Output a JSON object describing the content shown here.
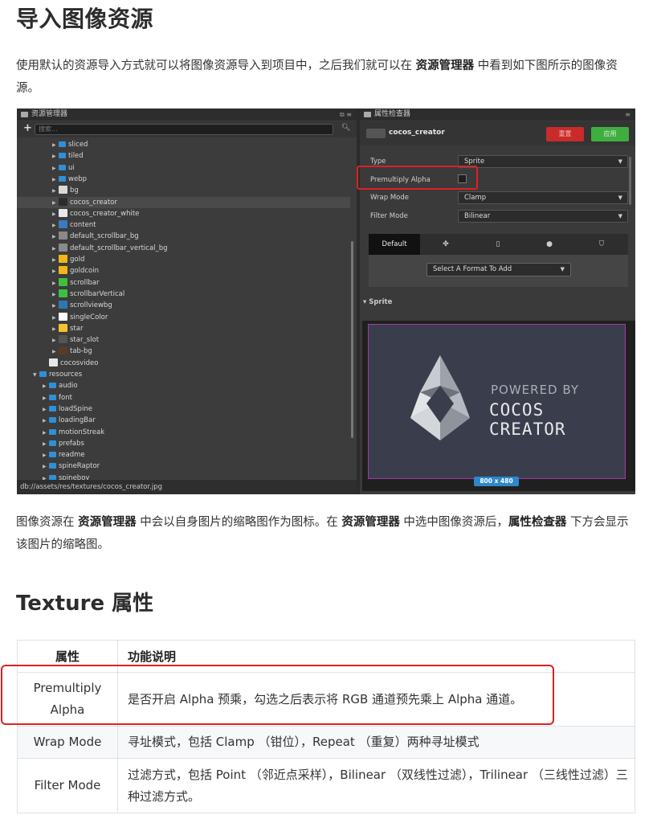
{
  "heading1": "导入图像资源",
  "intro": {
    "part1": "使用默认的资源导入方式就可以将图像资源导入到项目中，之后我们就可以在 ",
    "bold1": "资源管理器",
    "part2": " 中看到如下图所示的图像资源。"
  },
  "assets_panel": {
    "title": "资源管理器",
    "search_placeholder": "搜索...",
    "status_path": "db://assets/res/textures/cocos_creator.jpg",
    "tree": [
      {
        "name": "sliced",
        "kind": "folder",
        "indent": 2
      },
      {
        "name": "tiled",
        "kind": "folder",
        "indent": 2
      },
      {
        "name": "ui",
        "kind": "folder",
        "indent": 2
      },
      {
        "name": "webp",
        "kind": "folder",
        "indent": 2
      },
      {
        "name": "bg",
        "kind": "image",
        "indent": 2,
        "color": "#d9d9d9"
      },
      {
        "name": "cocos_creator",
        "kind": "image",
        "indent": 2,
        "color": "#2c2c2c",
        "selected": true
      },
      {
        "name": "cocos_creator_white",
        "kind": "image",
        "indent": 2,
        "color": "#e8e8e8"
      },
      {
        "name": "content",
        "kind": "image",
        "indent": 2,
        "color": "#3a7abf"
      },
      {
        "name": "default_scrollbar_bg",
        "kind": "image",
        "indent": 2,
        "color": "#8a8a8a"
      },
      {
        "name": "default_scrollbar_vertical_bg",
        "kind": "image",
        "indent": 2,
        "color": "#8a8a8a"
      },
      {
        "name": "gold",
        "kind": "image",
        "indent": 2,
        "color": "#f2b619"
      },
      {
        "name": "goldcoin",
        "kind": "image",
        "indent": 2,
        "color": "#f2b619"
      },
      {
        "name": "scrollbar",
        "kind": "image",
        "indent": 2,
        "color": "#3fbf3f"
      },
      {
        "name": "scrollbarVertical",
        "kind": "image",
        "indent": 2,
        "color": "#3fbf3f"
      },
      {
        "name": "scrollviewbg",
        "kind": "image",
        "indent": 2,
        "color": "#2d78b0"
      },
      {
        "name": "singleColor",
        "kind": "image",
        "indent": 2,
        "color": "#ffffff"
      },
      {
        "name": "star",
        "kind": "image",
        "indent": 2,
        "color": "#f2c230"
      },
      {
        "name": "star_slot",
        "kind": "image",
        "indent": 2,
        "color": "#555555"
      },
      {
        "name": "tab-bg",
        "kind": "image",
        "indent": 2,
        "color": "#5a3b25"
      },
      {
        "name": "cocosvideo",
        "kind": "file",
        "indent": 1,
        "color": "#e6e6e6"
      },
      {
        "name": "resources",
        "kind": "folder-open",
        "indent": 0
      },
      {
        "name": "audio",
        "kind": "folder",
        "indent": 1
      },
      {
        "name": "font",
        "kind": "folder",
        "indent": 1
      },
      {
        "name": "loadSpine",
        "kind": "folder",
        "indent": 1
      },
      {
        "name": "loadingBar",
        "kind": "folder",
        "indent": 1
      },
      {
        "name": "motionStreak",
        "kind": "folder",
        "indent": 1
      },
      {
        "name": "prefabs",
        "kind": "folder",
        "indent": 1
      },
      {
        "name": "readme",
        "kind": "folder",
        "indent": 1
      },
      {
        "name": "spineRaptor",
        "kind": "folder",
        "indent": 1
      },
      {
        "name": "spineboy",
        "kind": "folder",
        "indent": 1
      }
    ]
  },
  "inspector": {
    "title": "属性检查器",
    "asset_name": "cocos_creator",
    "revert_label": "重置",
    "apply_label": "应用",
    "props": [
      {
        "label": "Type",
        "value": "Sprite"
      },
      {
        "label": "Premultiply Alpha",
        "value": ""
      },
      {
        "label": "Wrap Mode",
        "value": "Clamp"
      },
      {
        "label": "Filter Mode",
        "value": "Bilinear"
      }
    ],
    "platform_default": "Default",
    "format_select": "Select A Format To Add",
    "sprite_section": "▾ Sprite",
    "preview_line1": "POWERED BY",
    "preview_line2": "COCOS CREATOR",
    "preview_size": "800 x 480"
  },
  "para2": {
    "a": "图像资源在 ",
    "b1": "资源管理器",
    "c": " 中会以自身图片的缩略图作为图标。在 ",
    "b2": "资源管理器",
    "d": " 中选中图像资源后，",
    "b3": "属性检查器",
    "e": " 下方会显示该图片的缩略图。"
  },
  "heading2": "Texture 属性",
  "table": {
    "headers": [
      "属性",
      "功能说明"
    ],
    "rows": [
      [
        "Premultiply Alpha",
        "是否开启 Alpha 预乘，勾选之后表示将 RGB 通道预先乘上 Alpha 通道。"
      ],
      [
        "Wrap Mode",
        "寻址模式，包括 Clamp （钳位），Repeat （重复）两种寻址模式"
      ],
      [
        "Filter Mode",
        "过滤方式，包括 Point （邻近点采样），Bilinear （双线性过滤），Trilinear （三线性过滤）三种过滤方式。"
      ]
    ]
  }
}
